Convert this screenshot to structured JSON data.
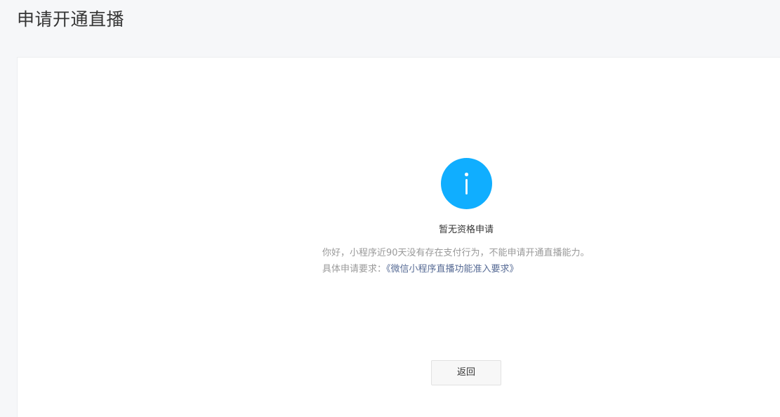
{
  "header": {
    "title": "申请开通直播"
  },
  "result": {
    "icon": "info-icon",
    "icon_color": "#10aeff",
    "title": "暂无资格申请",
    "description_line1": "你好，小程序近90天没有存在支付行为，不能申请开通直播能力。",
    "requirement_prefix": "具体申请要求：",
    "requirement_link": "《微信小程序直播功能准入要求》",
    "link_color": "#576b95"
  },
  "actions": {
    "back_label": "返回"
  }
}
